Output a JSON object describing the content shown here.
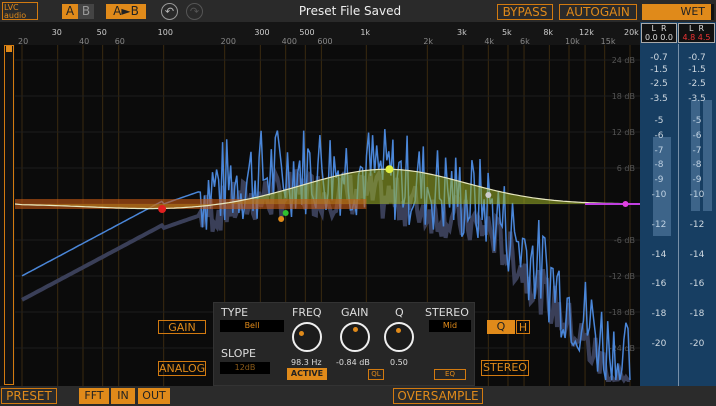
{
  "header": {
    "logo": "LVC audio",
    "a": "A",
    "b": "B",
    "copy": "A►B",
    "undo_icon": "undo-arrow",
    "redo_icon": "redo-arrow",
    "status": "Preset File Saved",
    "bypass": "BYPASS",
    "autogain": "AUTOGAIN",
    "wet": "WET"
  },
  "freq_scale": {
    "upper": [
      "30",
      "50",
      "100",
      "300",
      "500",
      "1k",
      "3k",
      "5k",
      "8k",
      "12k",
      "20k"
    ],
    "lower": [
      "20",
      "40",
      "60",
      "200",
      "400",
      "600",
      "2k",
      "4k",
      "6k",
      "10k",
      "15k"
    ]
  },
  "db_scale": [
    "24 dB",
    "18 dB",
    "12 dB",
    "6 dB",
    "-6 dB",
    "-12 dB",
    "-18 dB",
    "-24 dB"
  ],
  "meter": {
    "in": {
      "l_label": "L",
      "r_label": "R",
      "l_peak": "0.0",
      "r_peak": "0.0"
    },
    "out": {
      "l_label": "L",
      "r_label": "R",
      "l_peak": "4.8",
      "r_peak": "4.5"
    },
    "scale": [
      "-0.7",
      "-1.5",
      "-2.5",
      "-3.5",
      "-5",
      "-6",
      "-7",
      "-8",
      "-9",
      "-10",
      "-12",
      "-14",
      "-16",
      "-18",
      "-20"
    ],
    "in_level_db": -10.5,
    "out_level_db": -3.5
  },
  "side_buttons": {
    "gain": "GAIN",
    "analog": "ANALOG",
    "q": "Q",
    "h": "H",
    "stereo": "STEREO"
  },
  "band": {
    "type_label": "TYPE",
    "type_value": "Bell",
    "slope_label": "SLOPE",
    "slope_value": "12dB",
    "freq_label": "FREQ",
    "freq_value": "98.3 Hz",
    "gain_label": "GAIN",
    "gain_value": "-0.84 dB",
    "q_label": "Q",
    "q_value": "0.50",
    "stereo_label": "STEREO",
    "stereo_value": "Mid",
    "active": "ACTIVE",
    "ql": "QL",
    "eq": "EQ"
  },
  "footer": {
    "preset": "PRESET",
    "fft": "FFT",
    "in": "IN",
    "out": "OUT",
    "oversample": "OVERSAMPLE"
  },
  "colors": {
    "accent": "#e08a1a",
    "meter_bg": "#173e62",
    "spectrum": "#4a86d8",
    "eq_curve": "#b8c830"
  }
}
